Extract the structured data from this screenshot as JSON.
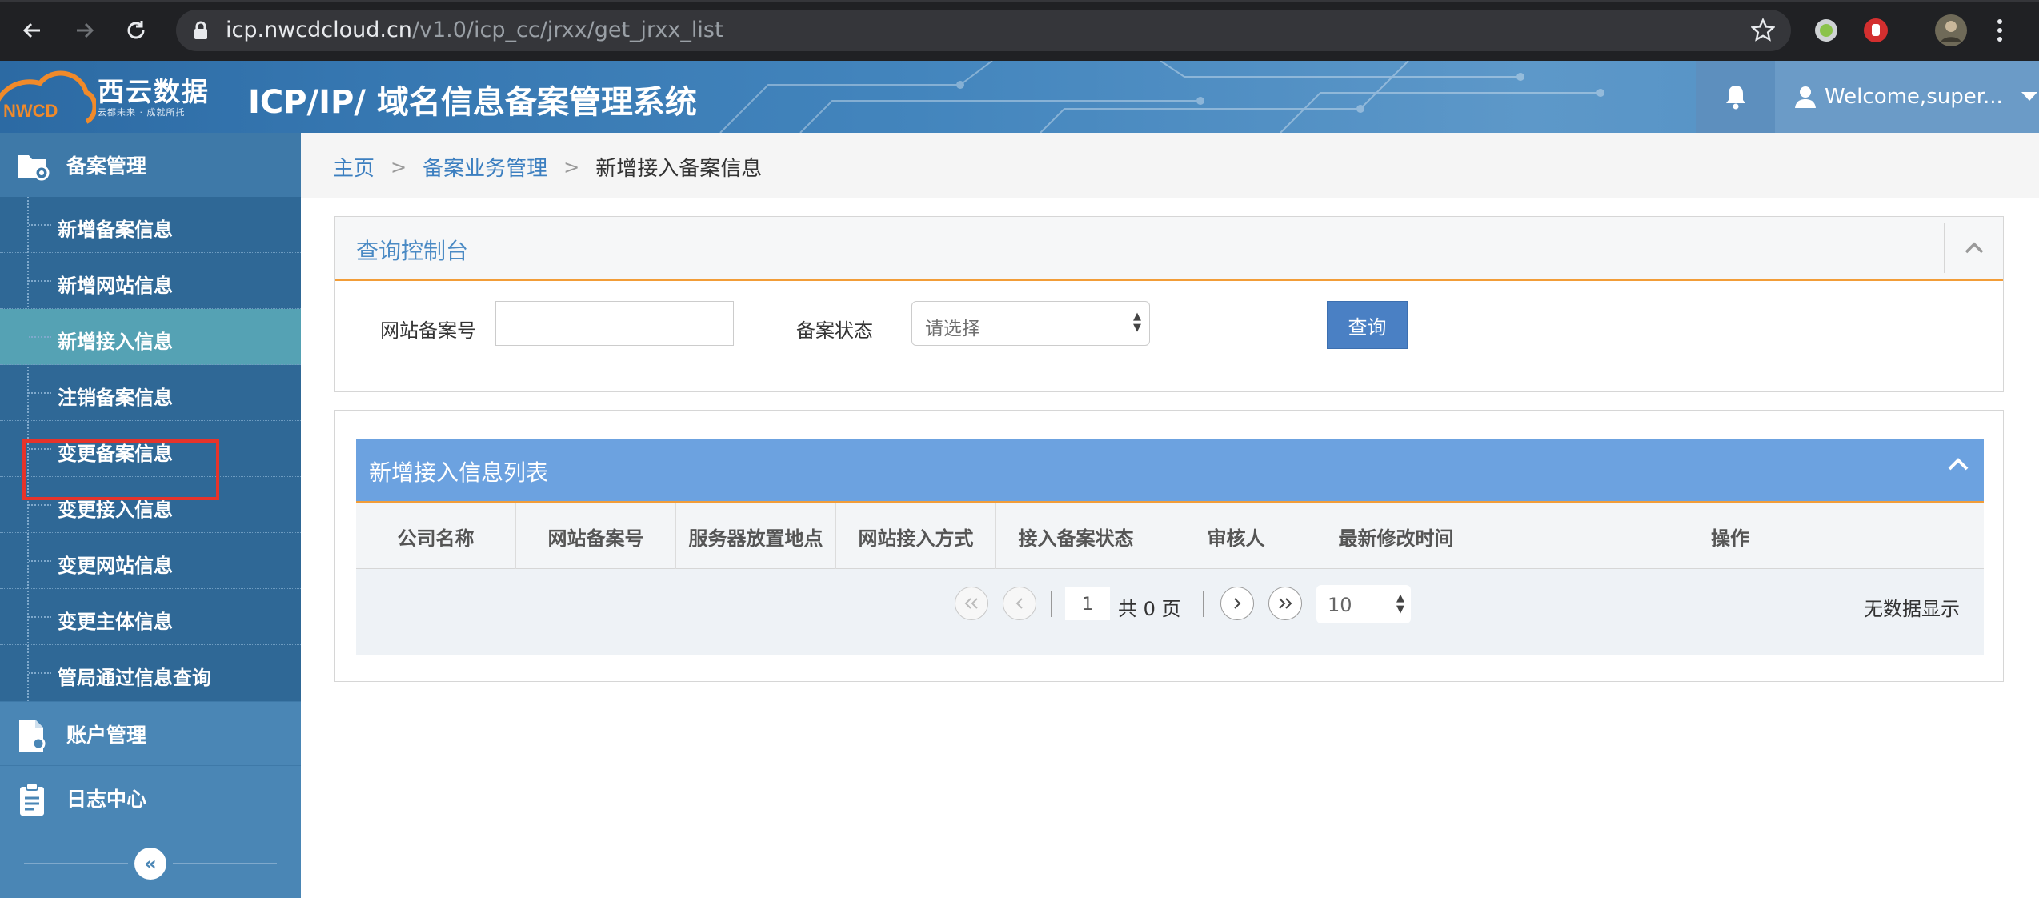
{
  "browser": {
    "url_host": "icp.nwcdcloud.cn",
    "url_path": "/v1.0/icp_cc/jrxx/get_jrxx_list"
  },
  "header": {
    "logo_text": "西云数据",
    "logo_sub": "云都未来 · 成就所托",
    "logo_mark": "NWCD",
    "title": "ICP/IP/ 域名信息备案管理系统",
    "welcome": "Welcome,super..."
  },
  "sidebar": {
    "group_records": "备案管理",
    "items": [
      {
        "label": "新增备案信息"
      },
      {
        "label": "新增网站信息"
      },
      {
        "label": "新增接入信息"
      },
      {
        "label": "注销备案信息"
      },
      {
        "label": "变更备案信息"
      },
      {
        "label": "变更接入信息"
      },
      {
        "label": "变更网站信息"
      },
      {
        "label": "变更主体信息"
      },
      {
        "label": "管局通过信息查询"
      }
    ],
    "active_index": 2,
    "group_account": "账户管理",
    "group_logs": "日志中心",
    "collapse_glyph": "«"
  },
  "breadcrumb": {
    "home": "主页",
    "section": "备案业务管理",
    "current": "新增接入备案信息",
    "separator": ">"
  },
  "query": {
    "title": "查询控制台",
    "record_label": "网站备案号",
    "record_value": "",
    "status_label": "备案状态",
    "status_selected": "请选择",
    "submit": "查询"
  },
  "list": {
    "title": "新增接入信息列表",
    "columns": [
      "公司名称",
      "网站备案号",
      "服务器放置地点",
      "网站接入方式",
      "接入备案状态",
      "审核人",
      "最新修改时间",
      "操作"
    ],
    "rows": []
  },
  "pager": {
    "current_page": "1",
    "total_text": "共 0 页",
    "page_size": "10",
    "empty_text": "无数据显示"
  },
  "colors": {
    "sidebar": "#4a86b5",
    "active": "#55a2b4",
    "accent_orange": "#f29d38",
    "list_header": "#6ca2e0",
    "query_button": "#4a80c4",
    "highlight_box": "#e6332a"
  }
}
